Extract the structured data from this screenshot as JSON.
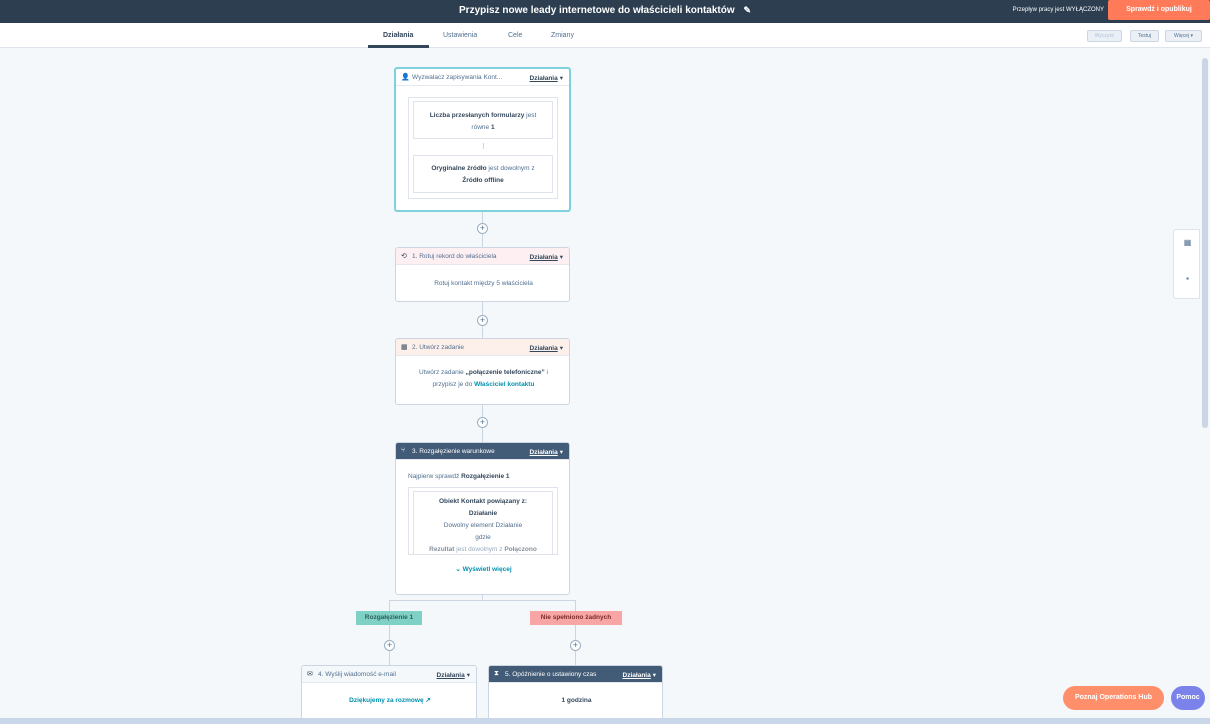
{
  "header": {
    "title": "Przypisz nowe leady internetowe do właścicieli kontaktów",
    "status": "Przepływ pracy jest WYŁĄCZONY",
    "review_button": "Sprawdź i opublikuj"
  },
  "tabs": [
    {
      "label": "Działania"
    },
    {
      "label": "Ustawienia"
    },
    {
      "label": "Cele"
    },
    {
      "label": "Zmiany"
    }
  ],
  "toolbar": {
    "clear": "Wyczyść",
    "test": "Testuj",
    "more": "Więcej"
  },
  "actions_label": "Działania",
  "trigger": {
    "title": "Wyzwalacz zapisywania Kont...",
    "cond1_bold": "Liczba przesłanych formularzy",
    "cond1_rest": "jest",
    "cond1_rest2": "równe",
    "cond1_value": "1",
    "cond2_bold": "Oryginalne źródło",
    "cond2_rest": "jest dowolnym z",
    "cond2_value": "Źródło offline"
  },
  "step1": {
    "title": "1. Rotuj rekord do właściciela",
    "body": "Rotuj kontakt między 5 właściciela"
  },
  "step2": {
    "title": "2. Utwórz zadanie",
    "body_pre": "Utwórz zadanie",
    "body_bold": "„połączenie telefoniczne”",
    "body_mid": "i",
    "body_line2": "przypisz je do",
    "body_link": "Właściciel kontaktu"
  },
  "step3": {
    "title": "3. Rozgałęzienie warunkowe",
    "first_check_pre": "Najpierw sprawdź",
    "first_check_bold": "Rozgałęzienie 1",
    "inner_bold1": "Obiekt Kontakt powiązany z:",
    "inner_bold2": "Działanie",
    "inner_line3": "Dowolny element Działanie",
    "inner_line4": "gdzie",
    "inner_line5_bold": "Rezultat",
    "inner_line5_rest": "jest dowolnym z",
    "inner_line5_bold2": "Połączono",
    "show_more": "Wyświetl więcej"
  },
  "branches": {
    "left": "Rozgałęzienie 1",
    "right": "Nie spełniono żadnych"
  },
  "step4": {
    "title": "4. Wyślij wiadomość e-mail",
    "body_link": "Dziękujemy za rozmowę"
  },
  "step5": {
    "title": "5. Opóźnienie o ustawiony czas",
    "body": "1 godzina"
  },
  "fab": {
    "ops_hub": "Poznaj Operations Hub",
    "help": "Pomoc"
  },
  "colors": {
    "header_bg": "#2d3e50",
    "accent_orange": "#ff7a59",
    "branch_teal": "#7fd1c6",
    "branch_red": "#f8a5a5",
    "help_purple": "#7b83eb"
  }
}
